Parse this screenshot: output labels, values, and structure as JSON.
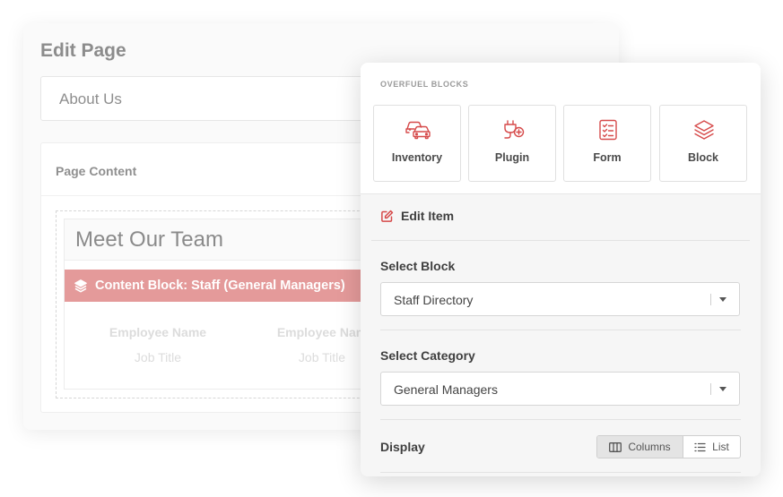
{
  "edit_page": {
    "title": "Edit Page",
    "title_value": "About Us",
    "content_card_title": "Page Content",
    "heading": "Meet Our Team",
    "content_block_label": "Content Block: Staff (General Managers)",
    "employees": [
      {
        "name": "Employee Name",
        "title": "Job Title"
      },
      {
        "name": "Employee Nam",
        "title": "Job Title"
      }
    ]
  },
  "overfuel": {
    "section_label": "OVERFUEL BLOCKS",
    "blocks": [
      {
        "label": "Inventory",
        "icon": "cars-icon"
      },
      {
        "label": "Plugin",
        "icon": "plug-add-icon"
      },
      {
        "label": "Form",
        "icon": "checklist-icon"
      },
      {
        "label": "Block",
        "icon": "layers-icon"
      }
    ],
    "edit_item_label": "Edit Item",
    "select_block_label": "Select Block",
    "select_block_value": "Staff Directory",
    "select_category_label": "Select Category",
    "select_category_value": "General Managers",
    "display_label": "Display",
    "display_options": {
      "columns": "Columns",
      "list": "List"
    },
    "display_selected": "Columns"
  },
  "colors": {
    "accent": "#d64a4a",
    "accent_muted": "#e49a9a",
    "panel_bg": "#f6f6f6"
  }
}
